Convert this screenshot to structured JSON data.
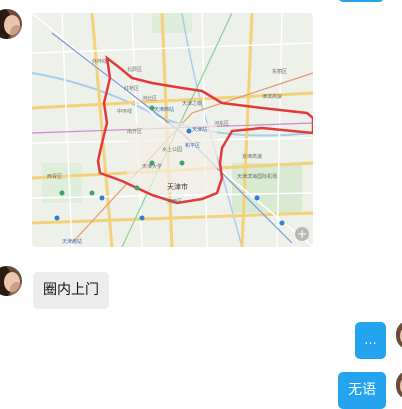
{
  "messages": [
    {
      "type": "image",
      "sender": "contact",
      "content": "map-image"
    },
    {
      "type": "text",
      "sender": "contact",
      "text": "圈内上门"
    },
    {
      "type": "text",
      "sender": "me",
      "text": "..."
    },
    {
      "type": "text",
      "sender": "me",
      "text": "无语"
    }
  ],
  "map": {
    "city_label": "天津市",
    "zoom_symbol": "+",
    "labels": [
      "北辰区",
      "河北区",
      "河东区",
      "东丽区",
      "南开区",
      "和平区",
      "天津站",
      "天津大学",
      "天津西站",
      "天津南站",
      "西青区",
      "天津滨海国际机场",
      "津滨高速",
      "外环线",
      "京津高速",
      "中环线",
      "红桥区",
      "河西区",
      "水上公园",
      "天津之眼"
    ],
    "route_color": "#e23a3a"
  },
  "colors": {
    "outgoing_bubble": "#24a3ee",
    "incoming_bubble": "#ececec"
  }
}
